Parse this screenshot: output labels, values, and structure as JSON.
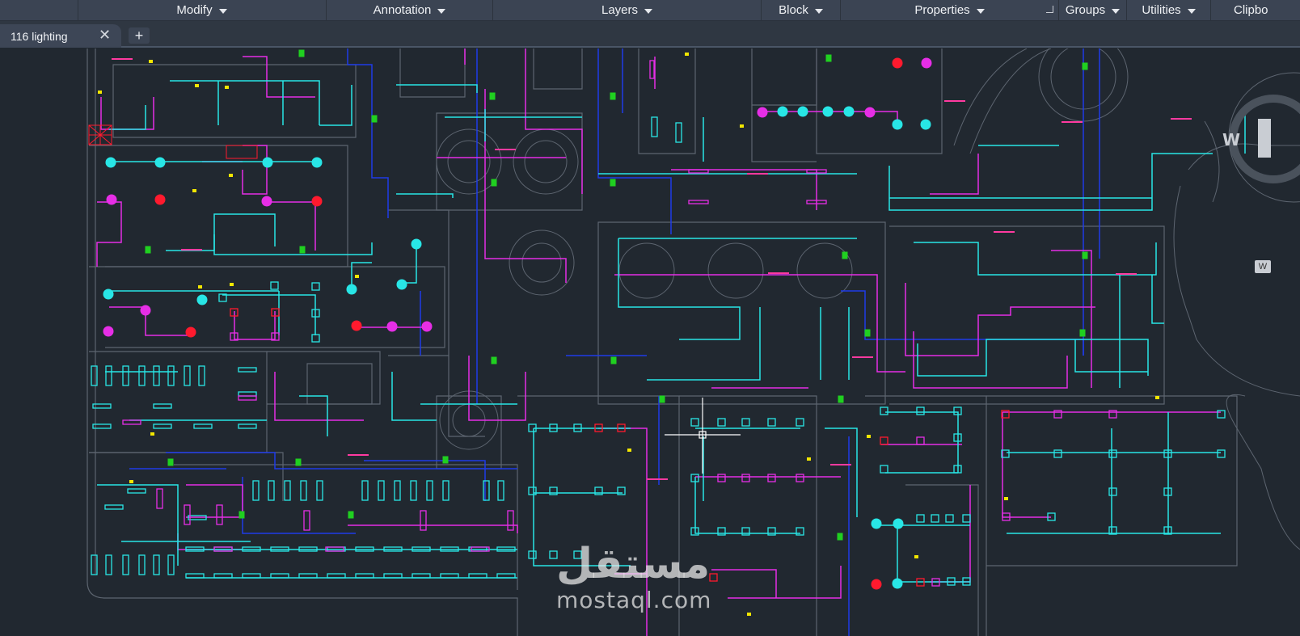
{
  "ribbon": {
    "panels": [
      {
        "label": "Modify"
      },
      {
        "label": "Annotation"
      },
      {
        "label": "Layers"
      },
      {
        "label": "Block"
      },
      {
        "label": "Properties"
      },
      {
        "label": "Groups"
      },
      {
        "label": "Utilities"
      },
      {
        "label": "Clipbo"
      }
    ],
    "properties_launcher_icon": "corner-arrow-icon"
  },
  "tabs": {
    "active_label": "116 lighting",
    "close_glyph": "✕",
    "new_tab_glyph": "+"
  },
  "drawing": {
    "compass_letter": "W",
    "side_tab_letter": "W"
  },
  "watermark": {
    "arabic": "مستقل",
    "latin": "mostaql.com"
  },
  "colors": {
    "background": "#212830",
    "ribbon": "#3b4453",
    "cyan": "#28e6e6",
    "magenta": "#e62ee6",
    "blue": "#1f3be8",
    "red": "#ff1a2e",
    "green": "#20d020",
    "yellow": "#f2e600",
    "wall": "#5d6570"
  }
}
